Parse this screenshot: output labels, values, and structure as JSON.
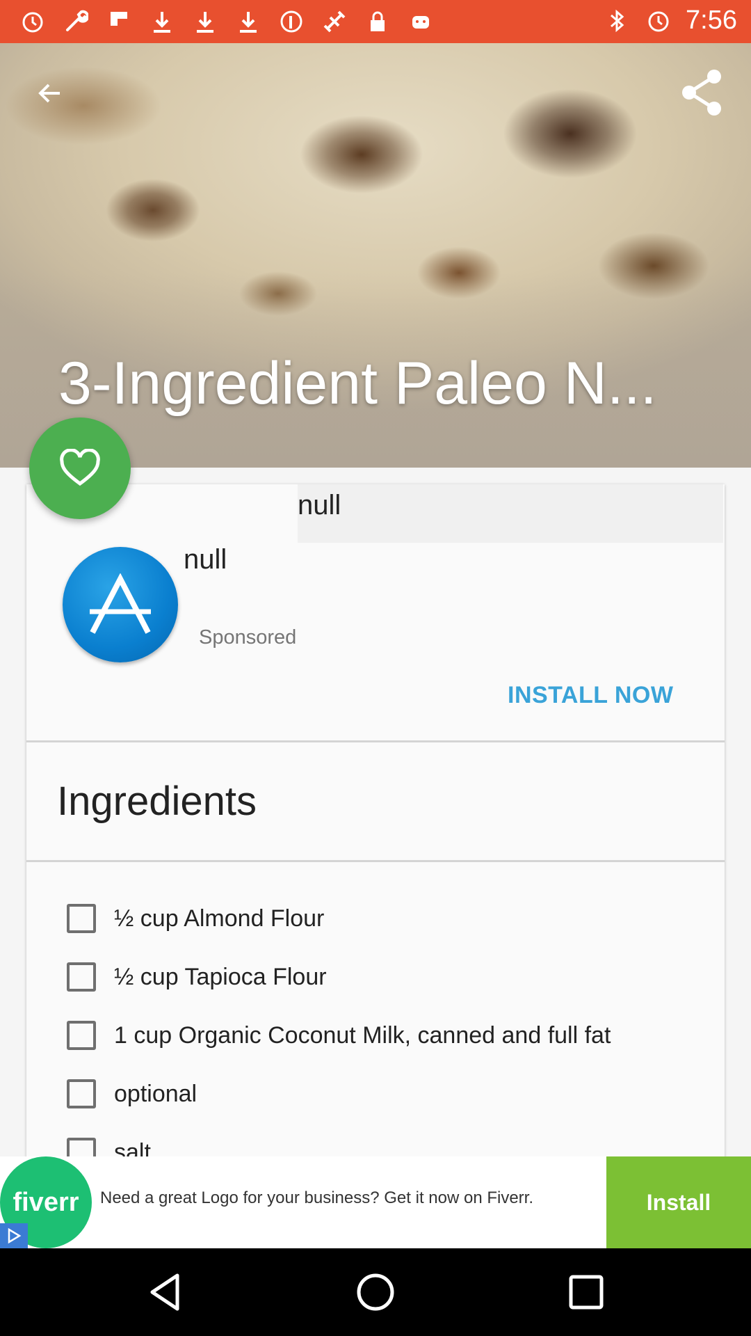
{
  "status_bar": {
    "time": "7:56",
    "left_icons": [
      "alarm-icon",
      "wrench-icon",
      "flipboard-icon",
      "download-icon",
      "download-icon",
      "download-icon",
      "pinterest-icon",
      "satellite-icon",
      "lock-icon",
      "android-icon"
    ],
    "right_icons": [
      "bluetooth-icon",
      "alarm-icon"
    ]
  },
  "hero": {
    "title": "3-Ingredient Paleo N..."
  },
  "ad_card": {
    "header_text": "null",
    "app_name": "null",
    "sponsored_label": "Sponsored",
    "install_label": "INSTALL NOW"
  },
  "ingredients": {
    "title": "Ingredients",
    "items": [
      {
        "label": "½ cup Almond Flour",
        "checked": false
      },
      {
        "label": "½ cup Tapioca Flour",
        "checked": false
      },
      {
        "label": "1 cup Organic Coconut Milk, canned and full fat",
        "checked": false
      },
      {
        "label": " optional",
        "checked": false
      },
      {
        "label": " salt",
        "checked": false
      }
    ]
  },
  "banner_ad": {
    "brand": "fiverr",
    "text": "Need a great Logo for your business? Get it now on Fiverr.",
    "install_label": "Install"
  },
  "colors": {
    "status_bar": "#e8502f",
    "fab": "#4caf50",
    "install_now": "#3aa3d8",
    "fiverr_green": "#1dbf73",
    "install_button": "#7cc034"
  }
}
